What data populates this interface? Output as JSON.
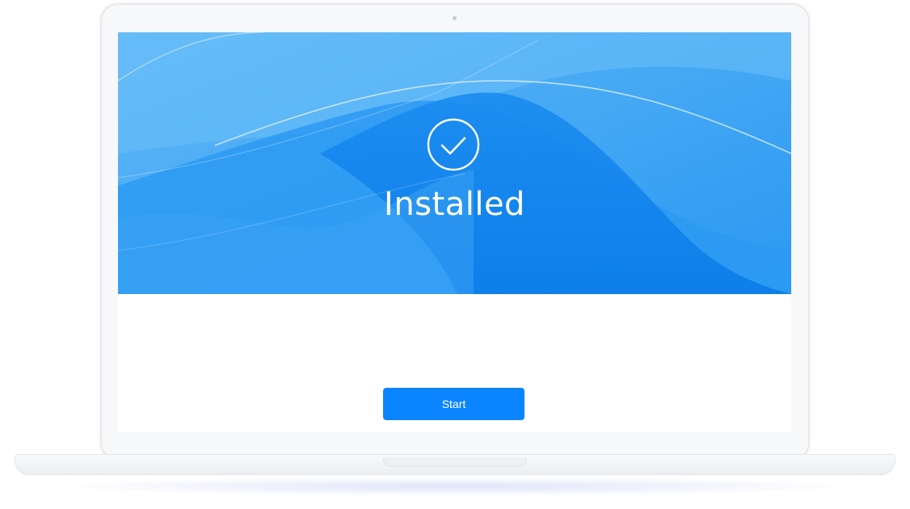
{
  "installer": {
    "status_title": "Installed",
    "status_icon": "check-circle-icon",
    "start_label": "Start"
  },
  "colors": {
    "hero_blue": "#1e8ff0",
    "button_blue": "#0a84ff",
    "text_white": "#ffffff"
  }
}
